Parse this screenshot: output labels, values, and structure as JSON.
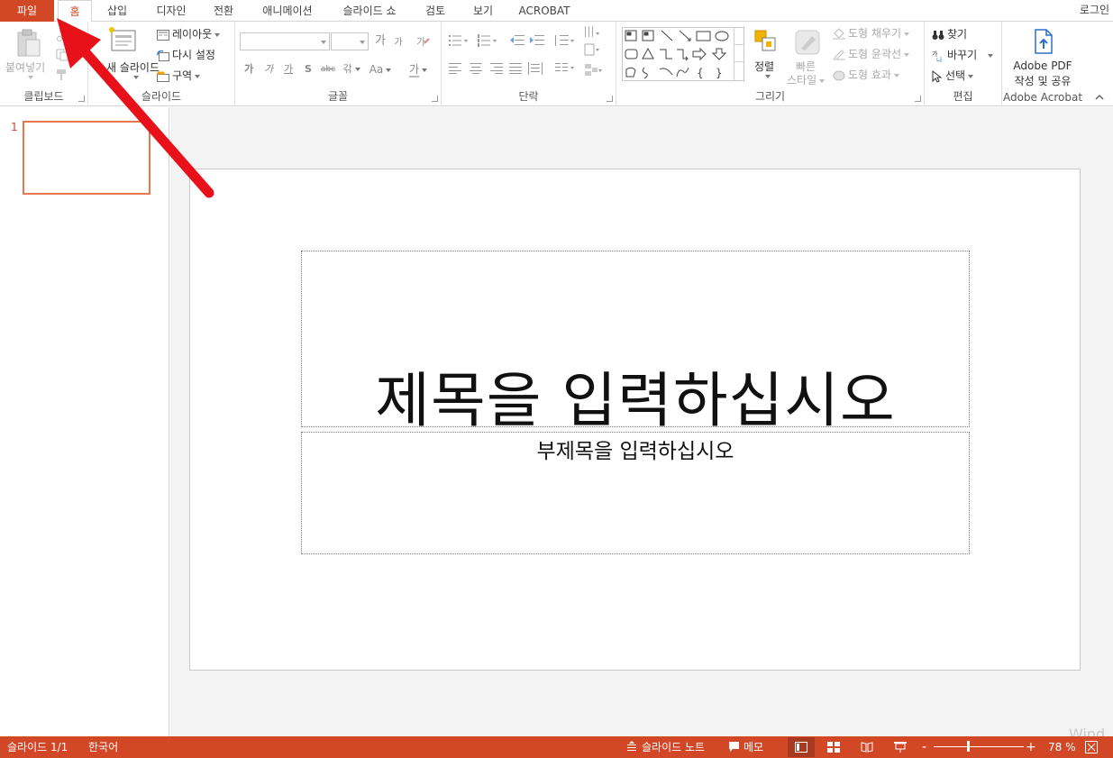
{
  "tabs": {
    "file": "파일",
    "home": "홈",
    "insert": "삽입",
    "design": "디자인",
    "transitions": "전환",
    "animations": "애니메이션",
    "slideshow": "슬라이드 쇼",
    "review": "검토",
    "view": "보기",
    "acrobat": "ACROBAT",
    "active": "홈"
  },
  "login": "로그인",
  "ribbon": {
    "clipboard": {
      "paste": "붙여넣기",
      "label": "클립보드"
    },
    "slides": {
      "new_slide": "새 슬라이드",
      "layout": "레이아웃",
      "reset": "다시 설정",
      "section": "구역",
      "label": "슬라이드"
    },
    "font": {
      "label": "글꼴",
      "font_name_value": "",
      "font_size_value": "",
      "grow": "가",
      "shrink": "가",
      "bold": "가",
      "italic": "가",
      "underline": "가",
      "shadow": "S",
      "strike": "abc",
      "spacing": "갂",
      "case": "Aa",
      "color": "가"
    },
    "paragraph": {
      "label": "단락"
    },
    "drawing": {
      "label": "그리기",
      "arrange": "정렬",
      "quick_styles": "빠른 스타일",
      "quick_styles_line1": "빠른",
      "quick_styles_line2": "스타일",
      "shape_fill": "도형 채우기",
      "shape_outline": "도형 윤곽선",
      "shape_effects": "도형 효과"
    },
    "editing": {
      "label": "편집",
      "find": "찾기",
      "replace": "바꾸기",
      "select": "선택"
    },
    "acrobat": {
      "label": "Adobe Acrobat",
      "create_line1": "Adobe PDF",
      "create_line2": "작성 및 공유"
    }
  },
  "thumbnails": {
    "slide_number": "1"
  },
  "slide": {
    "title_placeholder": "제목을 입력하십시오",
    "subtitle_placeholder": "부제목을 입력하십시오"
  },
  "statusbar": {
    "slide_count": "슬라이드 1/1",
    "language": "한국어",
    "notes": "슬라이드 노트",
    "comments": "메모",
    "zoom": "78 %",
    "zoom_minus": "-",
    "zoom_plus": "+"
  },
  "watermark": "Wind",
  "colors": {
    "accent": "#D24726",
    "thumb_border": "#E8774E",
    "arrow": "#E8111A"
  },
  "annotation": {
    "arrow_target": "파일 tab"
  }
}
